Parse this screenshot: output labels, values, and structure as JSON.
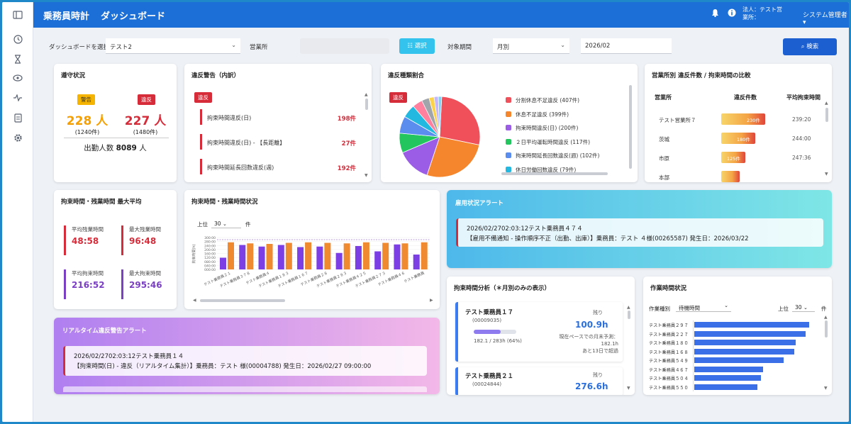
{
  "app": {
    "title": "乗務員時計",
    "page": "ダッシュボード"
  },
  "header": {
    "corp_line1": "法人：テスト営",
    "corp_line2": "業所：",
    "admin": "システム管理者"
  },
  "filters": {
    "dashboard_label": "ダッシュボードを選択",
    "dashboard_value": "テスト2",
    "office_label": "営業所",
    "select_button": "選択",
    "period_label": "対象期間",
    "period_type": "月別",
    "period_value": "2026/02",
    "search_button": "検索"
  },
  "compliance": {
    "title": "遵守状況",
    "warning_tag": "警告",
    "violation_tag": "違反",
    "warning_people": "228 人",
    "warning_count": "(1240件)",
    "violation_people": "227 人",
    "violation_count": "(1480件)",
    "attendance_label": "出勤人数",
    "attendance_value": "8089",
    "attendance_unit": "人"
  },
  "breakdown": {
    "title": "違反警告（内訳）",
    "tag": "違反",
    "rows": [
      {
        "label": "拘束時間違反(日)",
        "count": "198件"
      },
      {
        "label": "拘束時間違反(日) - 【長距離】",
        "count": "27件"
      },
      {
        "label": "拘束時間延長回数違反(週)",
        "count": "192件"
      }
    ]
  },
  "ratio": {
    "title": "違反種類割合",
    "tag": "違反",
    "items": [
      {
        "label": "分割休息不足違反 (407件)",
        "color": "#f0505a",
        "value": 407
      },
      {
        "label": "休息不足違反 (399件)",
        "color": "#f5862d",
        "value": 399
      },
      {
        "label": "拘束時間違反(日) (200件)",
        "color": "#9b5de5",
        "value": 200
      },
      {
        "label": "２日平均運転時間違反 (117件)",
        "color": "#22c55e",
        "value": 117
      },
      {
        "label": "拘束時間延長回数違反(週) (102件)",
        "color": "#5b8def",
        "value": 102
      },
      {
        "label": "休日労働回数違反 (79件)",
        "color": "#22b8e0",
        "value": 79
      },
      {
        "label": "",
        "color": "#ff7f9e",
        "value": 60
      },
      {
        "label": "",
        "color": "#a0a4ab",
        "value": 45
      },
      {
        "label": "",
        "color": "#fcd34d",
        "value": 30
      },
      {
        "label": "",
        "color": "#c4b5fd",
        "value": 25
      },
      {
        "label": "",
        "color": "#7dd3fc",
        "value": 20
      }
    ]
  },
  "office_compare": {
    "title": "営業所別 違反件数 / 拘束時間の比較",
    "col_office": "営業所",
    "col_count": "違反件数",
    "col_avg": "平均拘束時間",
    "rows": [
      {
        "office": "テスト営業所７",
        "count": "230件",
        "frac": 1.0,
        "avg": "239:20"
      },
      {
        "office": "茨城",
        "count": "180件",
        "frac": 0.78,
        "avg": "244:00"
      },
      {
        "office": "市原",
        "count": "125件",
        "frac": 0.55,
        "avg": "247:36"
      },
      {
        "office": "本部",
        "count": "",
        "frac": 0.42,
        "avg": ""
      }
    ]
  },
  "kpi": {
    "title": "拘束時間・残業時間 最大平均",
    "items": [
      {
        "label": "平均残業時間",
        "value": "48:58",
        "color": "#d62c3a"
      },
      {
        "label": "最大残業時間",
        "value": "96:48",
        "color": "#d62c3a"
      },
      {
        "label": "平均拘束時間",
        "value": "216:52",
        "color": "#7b3fc4"
      },
      {
        "label": "最大拘束時間",
        "value": "295:46",
        "color": "#7b3fc4"
      }
    ]
  },
  "constraint_chart": {
    "title": "拘束時間・残業時間状況",
    "top_label": "上位",
    "top_value": "30",
    "unit": "件",
    "ylabel": "拘束時間(h)"
  },
  "chart_data": {
    "type": "bar",
    "yticks": [
      "300:00",
      "280:00",
      "240:00",
      "200:00",
      "160:00",
      "120:00",
      "080:00",
      "040:00",
      "000:00"
    ],
    "ylim": [
      0,
      300
    ],
    "categories": [
      "テスト乗務員２１",
      "テスト乗務員３７８",
      "テスト乗務員４",
      "テスト乗務員１８３",
      "テスト乗務員１６７",
      "テスト乗務員２８",
      "テスト乗務員２８３",
      "テスト乗務員４２５",
      "テスト乗務員２７３",
      "テスト乗務員４６",
      "テスト乗務員"
    ],
    "series": [
      {
        "values": [
          110,
          230,
          215,
          230,
          210,
          215,
          155,
          220,
          170,
          235,
          140
        ]
      },
      {
        "values": [
          255,
          245,
          240,
          250,
          255,
          250,
          245,
          255,
          250,
          245,
          255
        ]
      }
    ]
  },
  "employment_alert": {
    "title": "雇用状況アラート",
    "line1": "2026/02/2702:03:12テスト乗務員４７４",
    "line2": "【雇用不備通知 - 操作順序不正（出勤、出庫）】乗務員：テスト ４様(00265587) 発生日：2026/03/22"
  },
  "realtime_alert": {
    "title": "リアルタイム違反警告アラート",
    "line1": "2026/02/2702:03:12テスト乗務員１４",
    "line2": "【拘束時間(日) - 違反（リアルタイム集計）】乗務員：テスト 様(00004788) 発生日：2026/02/27 09:00:00"
  },
  "analysis": {
    "title": "拘束時間分析（＊月別のみの表示）",
    "items": [
      {
        "name": "テスト乗務員１７",
        "id": "(00009035)",
        "remain_label": "残り",
        "remain": "100.9h",
        "usage": "182.1 / 283h (64%)",
        "frac": 0.64,
        "note1": "現在ペースでの月末予測：",
        "note2": "182.1h",
        "note3": "あと13日で超過"
      },
      {
        "name": "テスト乗務員２１",
        "id": "(00024844)",
        "remain_label": "残り",
        "remain": "276.6h"
      }
    ]
  },
  "work": {
    "title": "作業時間状況",
    "type_label": "作業種別",
    "type_value": "待機時間",
    "top_label": "上位",
    "top_value": "30",
    "unit": "件",
    "rows": [
      {
        "name": "テスト乗務員２９７",
        "value": 1.0
      },
      {
        "name": "テスト乗務員２２７",
        "value": 0.97
      },
      {
        "name": "テスト乗務員１８０",
        "value": 0.88
      },
      {
        "name": "テスト乗務員１６８",
        "value": 0.87
      },
      {
        "name": "テスト乗務員５４９",
        "value": 0.78
      },
      {
        "name": "テスト乗務員４６７",
        "value": 0.6
      },
      {
        "name": "テスト乗務員５０４",
        "value": 0.58
      },
      {
        "name": "テスト乗務員５５０",
        "value": 0.55
      }
    ]
  }
}
